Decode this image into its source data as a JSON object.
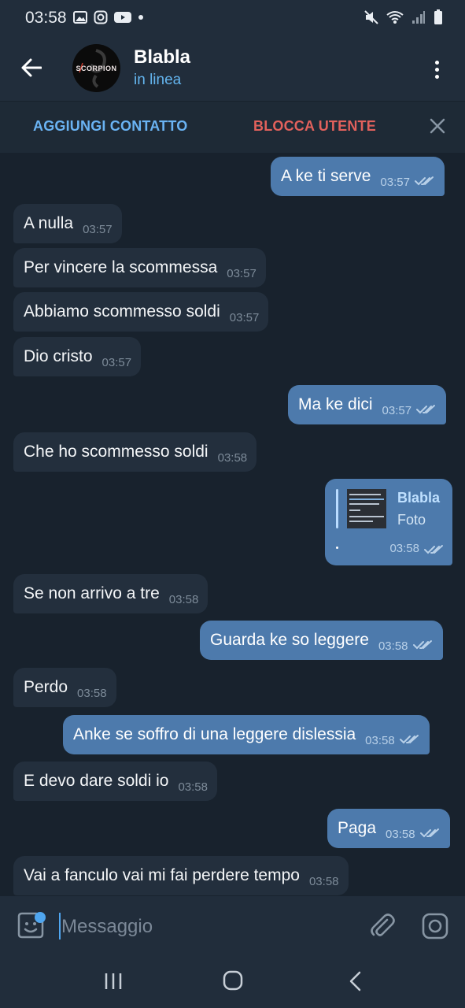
{
  "status_bar": {
    "time": "03:58",
    "left_icons": [
      "gallery-icon",
      "instagram-icon",
      "youtube-icon",
      "dot-icon"
    ],
    "right_icons": [
      "mute-icon",
      "wifi-icon",
      "signal-icon",
      "battery-icon"
    ]
  },
  "header": {
    "title": "Blabla",
    "status": "in linea",
    "avatar_text": "SCORPION"
  },
  "action_bar": {
    "add_contact": "AGGIUNGI CONTATTO",
    "block_user": "BLOCCA UTENTE"
  },
  "messages": [
    {
      "dir": "out",
      "text": "A ke ti serve",
      "time": "03:57"
    },
    {
      "dir": "in",
      "text": "A nulla",
      "time": "03:57"
    },
    {
      "dir": "in",
      "text": "Per vincere la scommessa",
      "time": "03:57"
    },
    {
      "dir": "in",
      "text": "Abbiamo scommesso soldi",
      "time": "03:57"
    },
    {
      "dir": "in",
      "text": "Dio cristo",
      "time": "03:57"
    },
    {
      "dir": "out",
      "text": "Ma ke dici",
      "time": "03:57"
    },
    {
      "dir": "in",
      "text": "Che ho scommesso soldi",
      "time": "03:58"
    },
    {
      "dir": "out",
      "type": "reply-photo",
      "reply_name": "Blabla",
      "reply_sub": "Foto",
      "time": "03:58"
    },
    {
      "dir": "in",
      "text": "Se non arrivo a tre",
      "time": "03:58"
    },
    {
      "dir": "out",
      "text": "Guarda ke so leggere",
      "time": "03:58"
    },
    {
      "dir": "in",
      "text": "Perdo",
      "time": "03:58"
    },
    {
      "dir": "out",
      "text": "Anke se soffro di una leggere dislessia",
      "time": "03:58"
    },
    {
      "dir": "in",
      "text": "E devo dare soldi io",
      "time": "03:58"
    },
    {
      "dir": "out",
      "text": "Paga",
      "time": "03:58"
    },
    {
      "dir": "in",
      "text": "Vai a fanculo vai mi fai perdere tempo",
      "time": "03:58"
    }
  ],
  "composer": {
    "placeholder": "Messaggio",
    "value": ""
  },
  "colors": {
    "background": "#18222d",
    "bar": "#212d3b",
    "incoming_bubble": "#232f3d",
    "outgoing_bubble": "#4d7aac",
    "accent": "#64b5ef",
    "danger": "#e2615c"
  }
}
